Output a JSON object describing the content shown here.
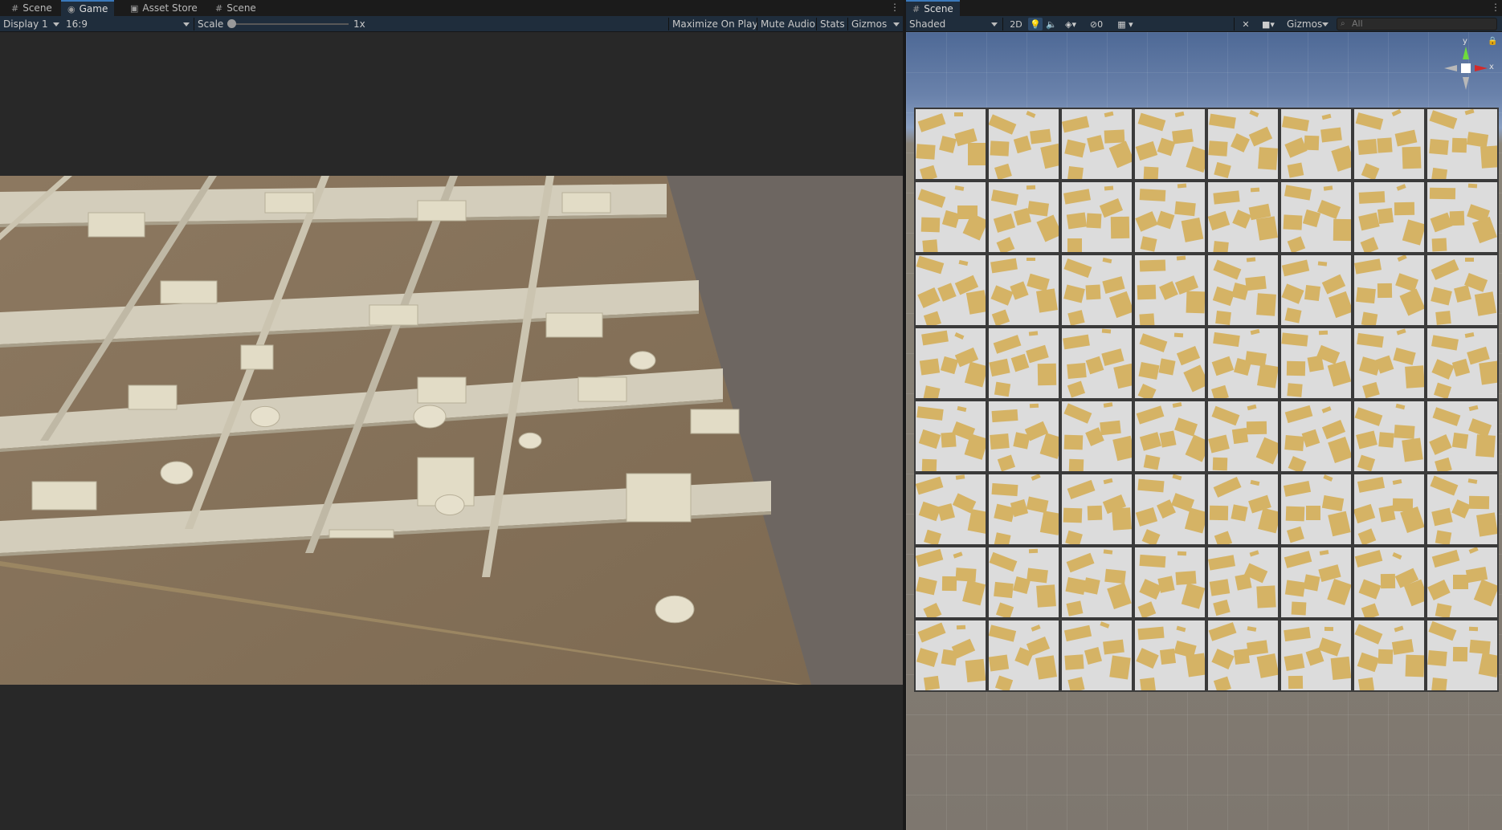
{
  "left_tabs": [
    {
      "icon": "scene-icon",
      "glyph": "#",
      "label": "Scene"
    },
    {
      "icon": "game-icon",
      "glyph": "◉",
      "label": "Game"
    },
    {
      "icon": "asset-store-icon",
      "glyph": "▣",
      "label": "Asset Store"
    },
    {
      "icon": "scene-icon",
      "glyph": "#",
      "label": "Scene"
    }
  ],
  "game_toolbar": {
    "display": "Display 1",
    "aspect": "16:9",
    "scale_label": "Scale",
    "scale_value": "1x",
    "maximize_on_play": "Maximize On Play",
    "mute_audio": "Mute Audio",
    "stats": "Stats",
    "gizmos": "Gizmos"
  },
  "right_tabs": [
    {
      "icon": "scene-icon",
      "glyph": "#",
      "label": "Scene"
    }
  ],
  "scene_toolbar": {
    "shading_mode": "Shaded",
    "mode_2d": "2D",
    "hidden_count": "0",
    "gizmos": "Gizmos",
    "search_placeholder": "All"
  },
  "gizmo_axes": {
    "y": "y",
    "x": "x"
  },
  "colors": {
    "accent": "#3a79bb",
    "furniture": "#d5b365",
    "floor": "#8f7a5e",
    "wall": "#cfc9b8"
  }
}
